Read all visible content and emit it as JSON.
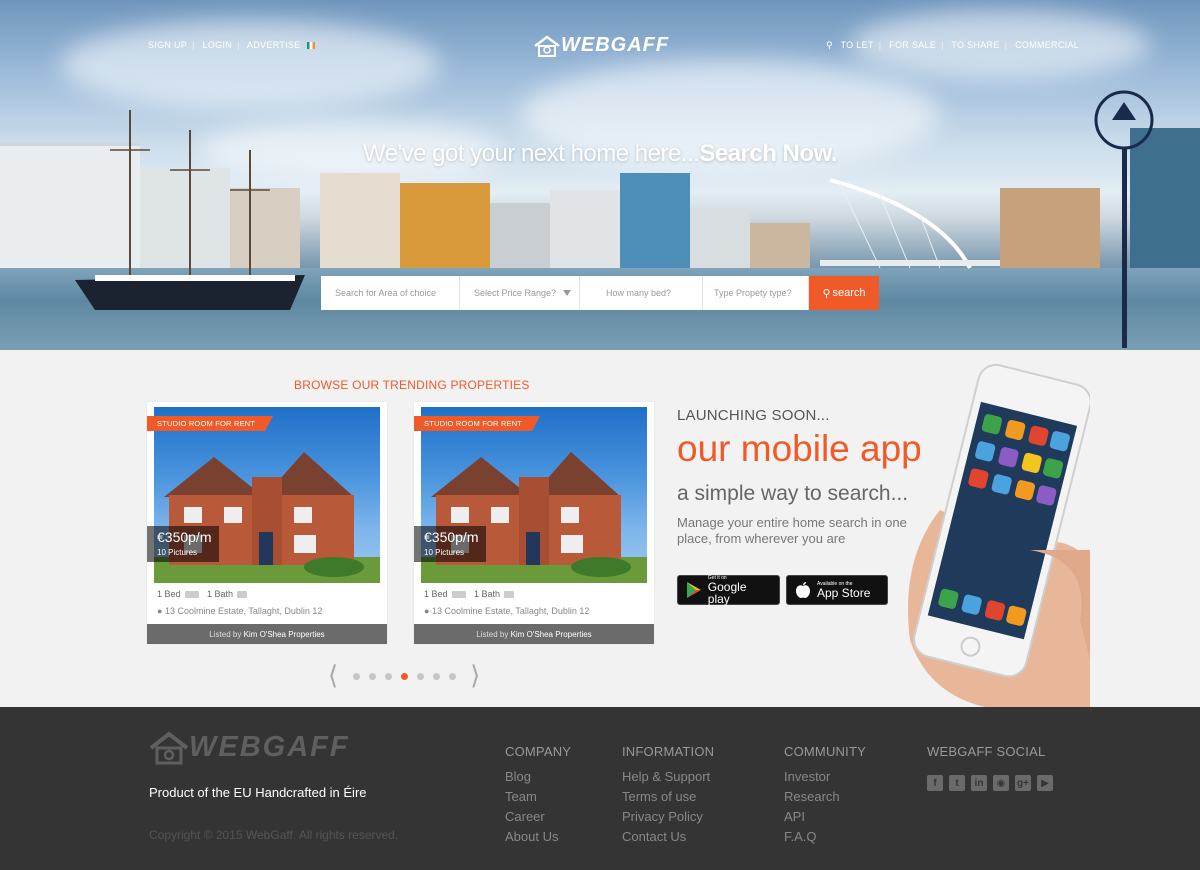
{
  "nav": {
    "left": [
      "SIGN UP",
      "LOGIN",
      "ADVERTISE"
    ],
    "right": [
      "TO LET",
      "FOR SALE",
      "TO SHARE",
      "COMMERCIAL"
    ]
  },
  "logo": "WEBGAFF",
  "hero": {
    "headline_light": "We've got your next home here...",
    "headline_bold": "Search Now."
  },
  "search": {
    "area_placeholder": "Search for Area of choice",
    "price_placeholder": "Select Price Range?",
    "beds_placeholder": "How many bed?",
    "type_placeholder": "Type Propety type?",
    "button": "search"
  },
  "trending": {
    "title": "BROWSE OUR TRENDING PROPERTIES",
    "cards": [
      {
        "ribbon": "STUDIO ROOM FOR RENT",
        "price": "€350p/m",
        "pictures": "10 Pictures",
        "beds": "1 Bed",
        "baths": "1 Bath",
        "address": "13 Coolmine Estate, Tallaght, Dublin 12",
        "listed_prefix": "Listed by",
        "listed_by": "Kim O'Shea Properties"
      },
      {
        "ribbon": "STUDIO ROOM FOR RENT",
        "price": "€350p/m",
        "pictures": "10 Pictures",
        "beds": "1 Bed",
        "baths": "1 Bath",
        "address": "13 Coolmine Estate, Tallaght, Dublin 12",
        "listed_prefix": "Listed by",
        "listed_by": "Kim O'Shea Properties"
      }
    ],
    "pager": {
      "total": 7,
      "active": 4
    }
  },
  "app": {
    "soon": "LAUNCHING SOON...",
    "title": "our mobile app",
    "subtitle": "a simple way to search...",
    "desc": "Manage your entire home search in one place, from wherever you are",
    "google_small": "Get it on",
    "google_big": "Google play",
    "apple_small": "Available on the",
    "apple_big": "App Store"
  },
  "footer": {
    "logo": "WEBGAFF",
    "tagline": "Product of the EU Handcrafted in Éire",
    "copyright": "Copyright © 2015 WebGaff. All rights reserved.",
    "columns": [
      {
        "title": "COMPANY",
        "links": [
          "Blog",
          "Team",
          "Career",
          "About Us"
        ]
      },
      {
        "title": "INFORMATION",
        "links": [
          "Help & Support",
          "Terms of use",
          "Privacy Policy",
          "Contact Us"
        ]
      },
      {
        "title": "COMMUNITY",
        "links": [
          "Investor",
          "Research",
          "API",
          "F.A.Q"
        ]
      }
    ],
    "social_title": "WEBGAFF SOCIAL",
    "social_icons": [
      "facebook-icon",
      "twitter-icon",
      "linkedin-icon",
      "instagram-icon",
      "google-plus-icon",
      "youtube-icon"
    ]
  },
  "colors": {
    "accent": "#f05a28",
    "footer": "#343434"
  }
}
